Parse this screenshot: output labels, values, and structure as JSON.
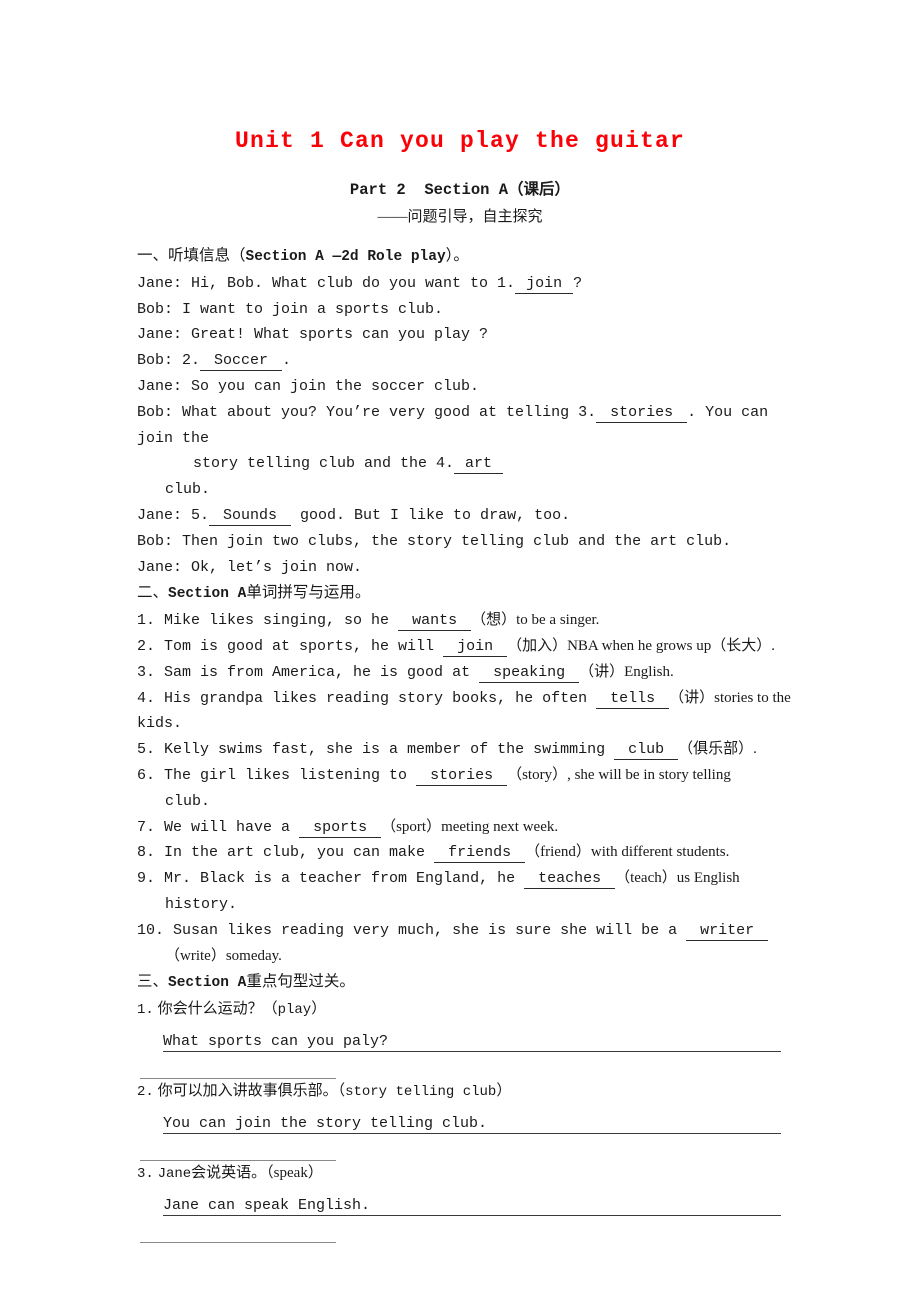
{
  "title": "Unit 1 Can you play the guitar",
  "title_color": "#fb0007",
  "subtitle_1": "Part 2  Section A（课后）",
  "subtitle_2": "——问题引导，自主探究",
  "section_one": {
    "heading_prefix": "一、听填信息（",
    "heading_en": "Section A —2d Role play",
    "heading_suffix": "）。",
    "lines": [
      {
        "id": "l1",
        "pre": "Jane: Hi, Bob. What club do you want to 1.",
        "blank": "join",
        "post": "?"
      },
      {
        "id": "l2",
        "pre": "Bob: I want to join a sports club."
      },
      {
        "id": "l3",
        "pre": "Jane: Great! What sports can you play ?"
      },
      {
        "id": "l4",
        "pre": "Bob: 2.",
        "blank": "Soccer",
        "post": "."
      },
      {
        "id": "l5",
        "pre": "Jane: So you can join the soccer club."
      },
      {
        "id": "l6",
        "pre": "Bob: What about you? You’re very good at telling 3.",
        "blank": "stories",
        "post": ". You can join the"
      },
      {
        "id": "l7",
        "indent": 2,
        "pre": "story telling club and the 4.",
        "blank": "art"
      },
      {
        "id": "l8",
        "indent": 1,
        "pre": "club."
      },
      {
        "id": "l9",
        "pre": "Jane: 5.",
        "blank": "Sounds",
        "post": " good. But I like to draw, too."
      },
      {
        "id": "l10",
        "pre": "Bob: Then join two clubs, the story telling club and the art club."
      },
      {
        "id": "l11",
        "pre": "Jane: Ok, let’s join now."
      }
    ]
  },
  "section_two": {
    "heading_prefix": "二、",
    "heading_en": "Section A",
    "heading_suffix": "单词拼写与运用。",
    "items": [
      {
        "num": "1.",
        "pre": " Mike likes singing, so he",
        "blank": "wants",
        "post": "（想）to be a singer."
      },
      {
        "num": "2.",
        "pre": " Tom is good at sports, he will",
        "blank": "join",
        "post": "（加入）NBA when he grows up（长大）."
      },
      {
        "num": "3.",
        "pre": " Sam is from America, he is good at",
        "blank": "speaking",
        "post": "（讲）English."
      },
      {
        "num": "4.",
        "pre": " His grandpa likes reading story books, he often",
        "blank": "tells",
        "post": "（讲）stories to the",
        "cont": "kids.",
        "cont_indent": 0
      },
      {
        "num": "5.",
        "pre": " Kelly swims fast, she is a member of the swimming",
        "blank": "club",
        "post": "（俱乐部）."
      },
      {
        "num": "6.",
        "pre": " The girl likes listening to",
        "blank": "stories",
        "post": "（story）, she will be in story telling",
        "cont": "club.",
        "cont_indent": 1
      },
      {
        "num": "7.",
        "pre": " We will have a",
        "blank": "sports",
        "post": "（sport）meeting next week."
      },
      {
        "num": "8.",
        "pre": " In the art club, you can make",
        "blank": "friends",
        "post": "（friend）with different students."
      },
      {
        "num": "9.",
        "pre": " Mr. Black is a teacher from England, he",
        "blank": "teaches",
        "post": "（teach）us English",
        "cont": "history.",
        "cont_indent": 1
      },
      {
        "num": "10.",
        "pre": " Susan likes reading very much, she is sure she will be a",
        "blank": "writer",
        "post": "",
        "cont": "（write）someday.",
        "cont_indent": 1
      }
    ]
  },
  "section_three": {
    "heading_prefix": "三、",
    "heading_en": "Section A",
    "heading_suffix": "重点句型过关。",
    "items": [
      {
        "num": "1.",
        "prompt_cjk": " 你会什么运动？（",
        "prompt_en": "play",
        "prompt_tail": "）",
        "answer": "What sports can you paly?"
      },
      {
        "num": "2.",
        "prompt_cjk": " 你可以加入讲故事俱乐部。（",
        "prompt_en": "story telling club",
        "prompt_tail": "）",
        "answer": "You can join the story telling club."
      },
      {
        "num": "3.",
        "prompt_cjk": " ",
        "prompt_en": "Jane",
        "prompt_tail": "会说英语。（speak）",
        "answer": "Jane can speak English."
      }
    ]
  }
}
